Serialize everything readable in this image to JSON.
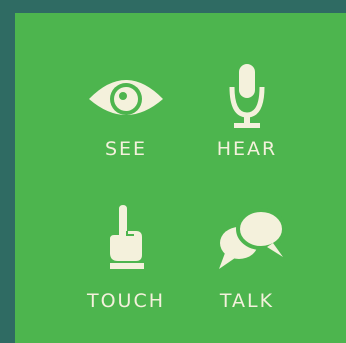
{
  "colors": {
    "background": "#2f6b63",
    "panel": "#4db54e",
    "icon_fill": "#f4f1dc"
  },
  "items": [
    {
      "label": "SEE",
      "icon": "eye-icon"
    },
    {
      "label": "HEAR",
      "icon": "microphone-icon"
    },
    {
      "label": "TOUCH",
      "icon": "pointing-hand-icon"
    },
    {
      "label": "TALK",
      "icon": "speech-bubbles-icon"
    }
  ]
}
